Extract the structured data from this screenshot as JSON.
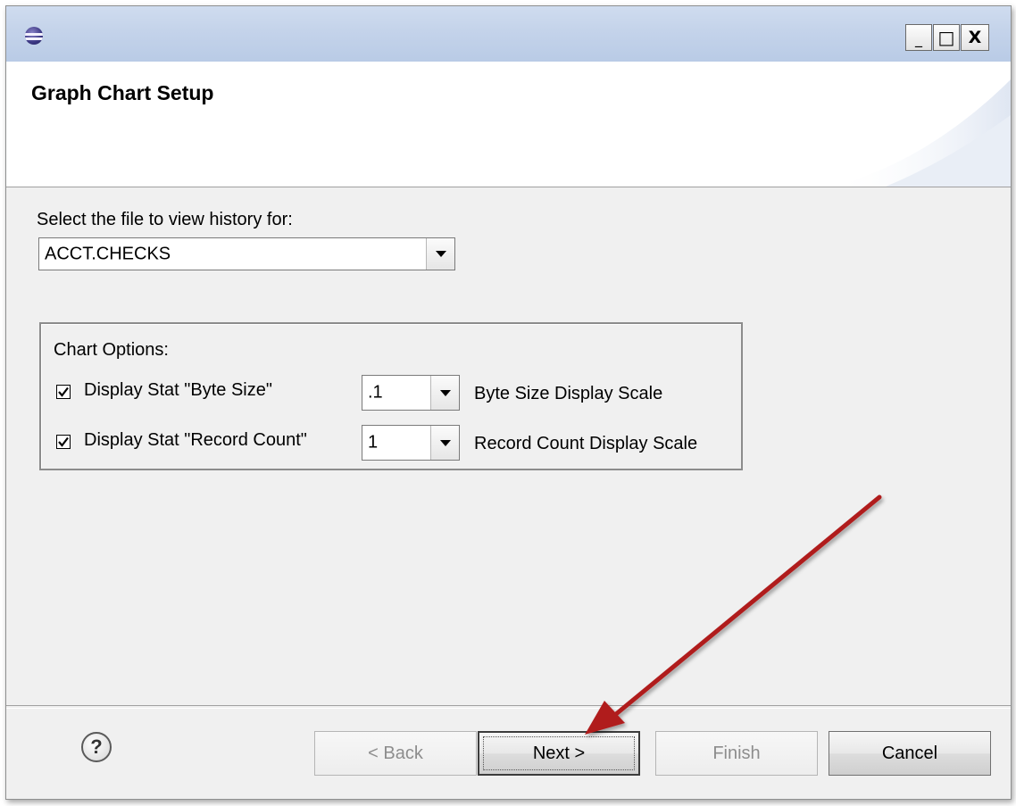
{
  "window": {
    "minimize_glyph": "_",
    "maximize_glyph": "□",
    "close_glyph": "X"
  },
  "header": {
    "title": "Graph Chart Setup"
  },
  "file_select": {
    "label": "Select the file to view history for:",
    "value": "ACCT.CHECKS"
  },
  "chart_options": {
    "title": "Chart Options:",
    "rows": [
      {
        "checked": true,
        "label": "Display Stat \"Byte Size\"",
        "scale_value": ".1",
        "scale_label": "Byte Size Display Scale"
      },
      {
        "checked": true,
        "label": "Display Stat \"Record Count\"",
        "scale_value": "1",
        "scale_label": "Record Count Display Scale"
      }
    ]
  },
  "buttons": {
    "help_glyph": "?",
    "back": "< Back",
    "next": "Next >",
    "finish": "Finish",
    "cancel": "Cancel"
  },
  "colors": {
    "annotation_arrow": "#b01c1c",
    "titlebar": "#c4d3ea"
  }
}
